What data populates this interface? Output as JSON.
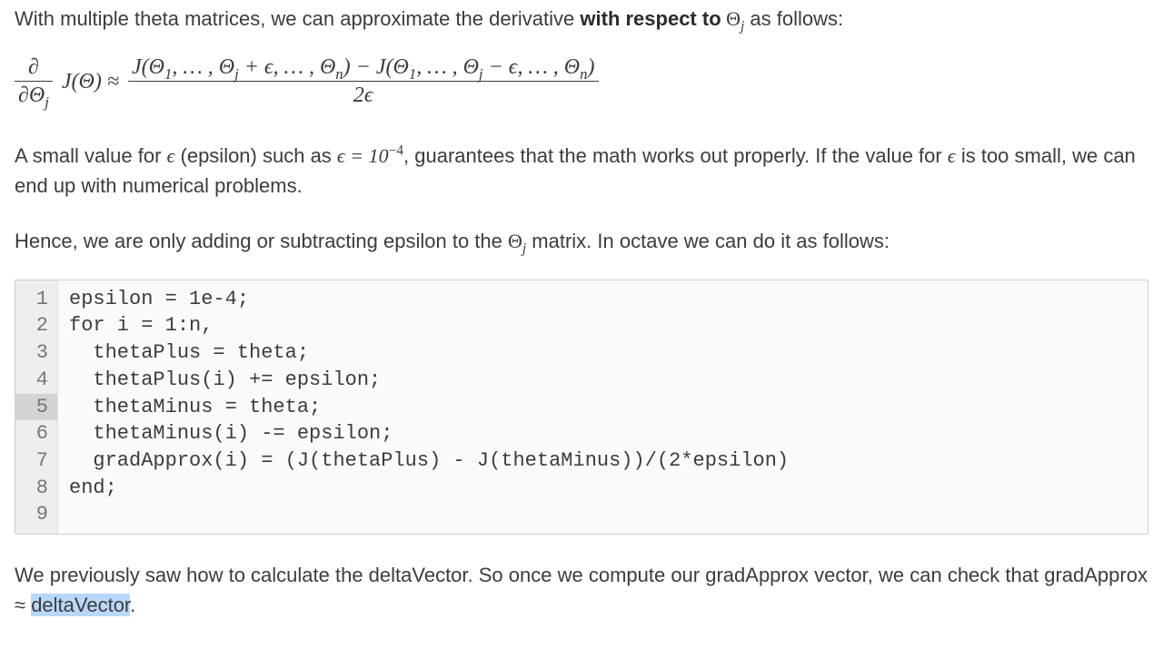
{
  "para1_a": "With multiple theta matrices, we can approximate the derivative ",
  "para1_b": "with respect to",
  "para1_c": " Θ",
  "para1_d": " as follows:",
  "para1_sub": "j",
  "formula": {
    "lhs_num": "∂",
    "lhs_den_a": "∂Θ",
    "lhs_den_sub": "j",
    "J": "J(Θ) ≈",
    "rhs_num": "J(Θ₁, … , Θⱼ + ϵ, … , Θₙ) − J(Θ₁, … , Θⱼ − ϵ, … , Θₙ)",
    "rhs_num_a": "J(Θ",
    "rhs_num_b": ", … , Θ",
    "rhs_num_c": " + ϵ, … , Θ",
    "rhs_num_d": ") − J(Θ",
    "rhs_num_e": ", … , Θ",
    "rhs_num_f": " − ϵ, … , Θ",
    "rhs_num_g": ")",
    "sub1": "1",
    "subj": "j",
    "subn": "n",
    "rhs_den": "2ϵ"
  },
  "para2_a": "A small value for ",
  "para2_eps1": "ϵ",
  "para2_b": " (epsilon) such as ",
  "para2_eq": "ϵ = 10",
  "para2_exp": "−4",
  "para2_c": ", guarantees that the math works out properly. If the value for ",
  "para2_eps2": "ϵ",
  "para2_d": " is too small, we can end up with numerical problems.",
  "para3_a": "Hence, we are only adding or subtracting epsilon to the ",
  "para3_theta": "Θ",
  "para3_sub": "j",
  "para3_b": " matrix. In octave we can do it as follows:",
  "code": {
    "lines": [
      "epsilon = 1e-4;",
      "for i = 1:n,",
      "  thetaPlus = theta;",
      "  thetaPlus(i) += epsilon;",
      "  thetaMinus = theta;",
      "  thetaMinus(i) -= epsilon;",
      "  gradApprox(i) = (J(thetaPlus) - J(thetaMinus))/(2*epsilon)",
      "end;",
      ""
    ],
    "numbers": [
      "1",
      "2",
      "3",
      "4",
      "5",
      "6",
      "7",
      "8",
      "9"
    ],
    "highlight_line_index": 4
  },
  "para4_a": "We previously saw how to calculate the deltaVector. So once we compute our gradApprox vector, we can check that gradApprox ≈ ",
  "para4_sel": "deltaVector",
  "para4_b": "."
}
